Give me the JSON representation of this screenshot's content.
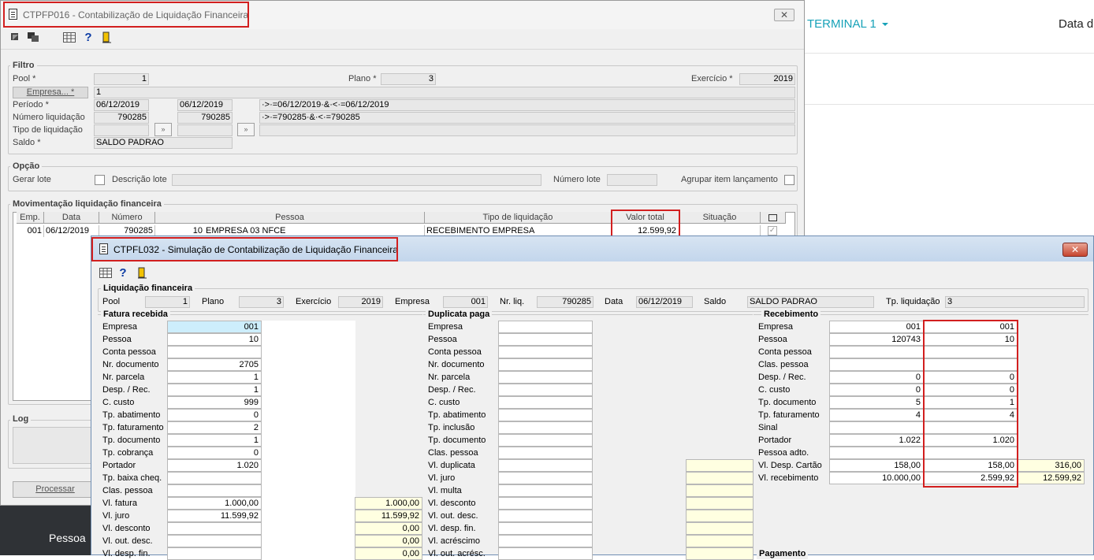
{
  "background_app": {
    "terminal": "TERMINAL 1",
    "date_label": "Data d",
    "pessoa_label": "Pessoa"
  },
  "win1": {
    "title": "CTPFP016 - Contabilização de Liquidação Financeira",
    "filtro": {
      "legend": "Filtro",
      "pool_label": "Pool *",
      "pool_value": "1",
      "plano_label": "Plano *",
      "plano_value": "3",
      "exercicio_label": "Exercício *",
      "exercicio_value": "2019",
      "empresa_button": "Empresa... *",
      "empresa_value": "1",
      "periodo_label": "Período *",
      "periodo_from": "06/12/2019",
      "periodo_to": "06/12/2019",
      "periodo_expr": "·>·=06/12/2019·&·<·=06/12/2019",
      "numero_label": "Número liquidação",
      "numero_from": "790285",
      "numero_to": "790285",
      "numero_expr": "·>·=790285·&·<·=790285",
      "tipo_label": "Tipo de liquidação",
      "saldo_label": "Saldo *",
      "saldo_value": "SALDO PADRAO"
    },
    "opcao": {
      "legend": "Opção",
      "gerar_lote": "Gerar lote",
      "descricao_lote": "Descrição lote",
      "numero_lote": "Número lote",
      "agrupar": "Agrupar item lançamento"
    },
    "mov": {
      "legend": "Movimentação liquidação financeira",
      "columns": [
        "Emp.",
        "Data",
        "Número",
        "Pessoa",
        "Tipo de liquidação",
        "Valor total",
        "Situação"
      ],
      "row": {
        "emp": "001",
        "data": "06/12/2019",
        "numero": "790285",
        "pessoa_cod": "10",
        "pessoa_nome": "EMPRESA 03 NFCE",
        "tipo": "RECEBIMENTO EMPRESA",
        "valor": "12.599,92"
      }
    },
    "log_legend": "Log",
    "processar": "Processar"
  },
  "win2": {
    "title": "CTPFL032 - Simulação de Contabilização de Liquidação Financeira",
    "liq": {
      "legend": "Liquidação financeira",
      "pool_label": "Pool",
      "pool": "1",
      "plano_label": "Plano",
      "plano": "3",
      "exercicio_label": "Exercício",
      "exercicio": "2019",
      "empresa_label": "Empresa",
      "empresa": "001",
      "nrliq_label": "Nr. liq.",
      "nrliq": "790285",
      "data_label": "Data",
      "data": "06/12/2019",
      "saldo_label": "Saldo",
      "saldo": "SALDO PADRAO",
      "tp_label": "Tp. liquidação",
      "tp": "3"
    },
    "fatura": {
      "legend": "Fatura recebida",
      "rows": [
        {
          "label": "Empresa",
          "v": "001",
          "t": null
        },
        {
          "label": "Pessoa",
          "v": "10",
          "t": null
        },
        {
          "label": "Conta pessoa",
          "v": "",
          "t": null
        },
        {
          "label": "Nr. documento",
          "v": "2705",
          "t": null
        },
        {
          "label": "Nr. parcela",
          "v": "1",
          "t": null
        },
        {
          "label": "Desp. / Rec.",
          "v": "1",
          "t": null
        },
        {
          "label": "C. custo",
          "v": "999",
          "t": null
        },
        {
          "label": "Tp. abatimento",
          "v": "0",
          "t": null
        },
        {
          "label": "Tp. faturamento",
          "v": "2",
          "t": null
        },
        {
          "label": "Tp. documento",
          "v": "1",
          "t": null
        },
        {
          "label": "Tp. cobrança",
          "v": "0",
          "t": null
        },
        {
          "label": "Portador",
          "v": "1.020",
          "t": null
        },
        {
          "label": "Tp. baixa cheq.",
          "v": "",
          "t": null
        },
        {
          "label": "Clas. pessoa",
          "v": "",
          "t": null
        },
        {
          "label": "Vl. fatura",
          "v": "1.000,00",
          "t": "1.000,00"
        },
        {
          "label": "Vl. juro",
          "v": "11.599,92",
          "t": "11.599,92"
        },
        {
          "label": "Vl. desconto",
          "v": "",
          "t": "0,00"
        },
        {
          "label": "Vl. out. desc.",
          "v": "",
          "t": "0,00"
        },
        {
          "label": "Vl. desp. fin.",
          "v": "",
          "t": "0,00"
        }
      ]
    },
    "duplicata": {
      "legend": "Duplicata paga",
      "rows": [
        {
          "label": "Empresa",
          "t": false
        },
        {
          "label": "Pessoa",
          "t": false
        },
        {
          "label": "Conta pessoa",
          "t": false
        },
        {
          "label": "Nr. documento",
          "t": false
        },
        {
          "label": "Nr. parcela",
          "t": false
        },
        {
          "label": "Desp. / Rec.",
          "t": false
        },
        {
          "label": "C. custo",
          "t": false
        },
        {
          "label": "Tp. abatimento",
          "t": false
        },
        {
          "label": "Tp. inclusão",
          "t": false
        },
        {
          "label": "Tp. documento",
          "t": false
        },
        {
          "label": "Clas. pessoa",
          "t": false
        },
        {
          "label": "Vl. duplicata",
          "t": true
        },
        {
          "label": "Vl. juro",
          "t": true
        },
        {
          "label": "Vl. multa",
          "t": true
        },
        {
          "label": "Vl. desconto",
          "t": true
        },
        {
          "label": "Vl. out. desc.",
          "t": true
        },
        {
          "label": "Vl. desp. fin.",
          "t": true
        },
        {
          "label": "Vl. acréscimo",
          "t": true
        },
        {
          "label": "Vl. out. acrésc.",
          "t": true
        }
      ]
    },
    "recebimento": {
      "legend": "Recebimento",
      "rows": [
        {
          "label": "Empresa",
          "a": "001",
          "b": "001",
          "t": null
        },
        {
          "label": "Pessoa",
          "a": "120743",
          "b": "10",
          "t": null
        },
        {
          "label": "Conta pessoa",
          "a": "",
          "b": "",
          "t": null
        },
        {
          "label": "Clas. pessoa",
          "a": "",
          "b": "",
          "t": null
        },
        {
          "label": "Desp. / Rec.",
          "a": "0",
          "b": "0",
          "t": null
        },
        {
          "label": "C. custo",
          "a": "0",
          "b": "0",
          "t": null
        },
        {
          "label": "Tp. documento",
          "a": "5",
          "b": "1",
          "t": null
        },
        {
          "label": "Tp. faturamento",
          "a": "4",
          "b": "4",
          "t": null
        },
        {
          "label": "Sinal",
          "a": "",
          "b": "",
          "t": null
        },
        {
          "label": "Portador",
          "a": "1.022",
          "b": "1.020",
          "t": null
        },
        {
          "label": "Pessoa adto.",
          "a": "",
          "b": "",
          "t": null
        },
        {
          "label": "Vl. Desp. Cartão",
          "a": "158,00",
          "b": "158,00",
          "t": "316,00"
        },
        {
          "label": "Vl. recebimento",
          "a": "10.000,00",
          "b": "2.599,92",
          "t": "12.599,92"
        }
      ]
    },
    "pagamento_legend": "Pagamento"
  }
}
